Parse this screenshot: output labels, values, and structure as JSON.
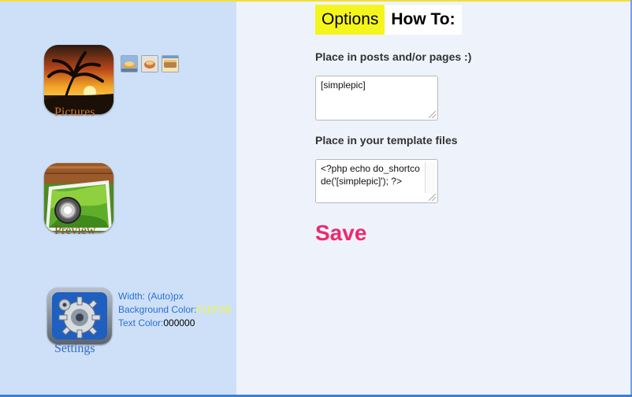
{
  "sidebar": {
    "apps": [
      {
        "id": "pictures",
        "label": "Pictures",
        "caption_color": "#c9783a"
      },
      {
        "id": "preview",
        "label": "Preview",
        "caption_color": "#8a5230"
      },
      {
        "id": "settings",
        "label": "Settings",
        "caption_color": "#3b6fcf"
      }
    ],
    "thumbnails": [
      "thumb-1",
      "thumb-2",
      "thumb-3"
    ],
    "settings_info": {
      "width_label": "Width: (Auto)px",
      "bg_label": "Background Color:",
      "bg_value": "F1EF2B",
      "text_label": "Text Color:",
      "text_value": "000000"
    }
  },
  "tabs": {
    "options": "Options",
    "howto": "How To:"
  },
  "main": {
    "posts_label": "Place in posts and/or pages :)",
    "posts_code": "[simplepic]",
    "template_label": "Place in your template files",
    "template_code": "<?php echo do_shortcode('[simplepic]'); ?>",
    "save_label": "Save"
  },
  "colors": {
    "sidebar_bg": "#cde0f8",
    "main_bg": "#eef3fb",
    "options_tab": "#f5f51e",
    "save": "#f0286e",
    "link_blue": "#2b6fd1"
  }
}
